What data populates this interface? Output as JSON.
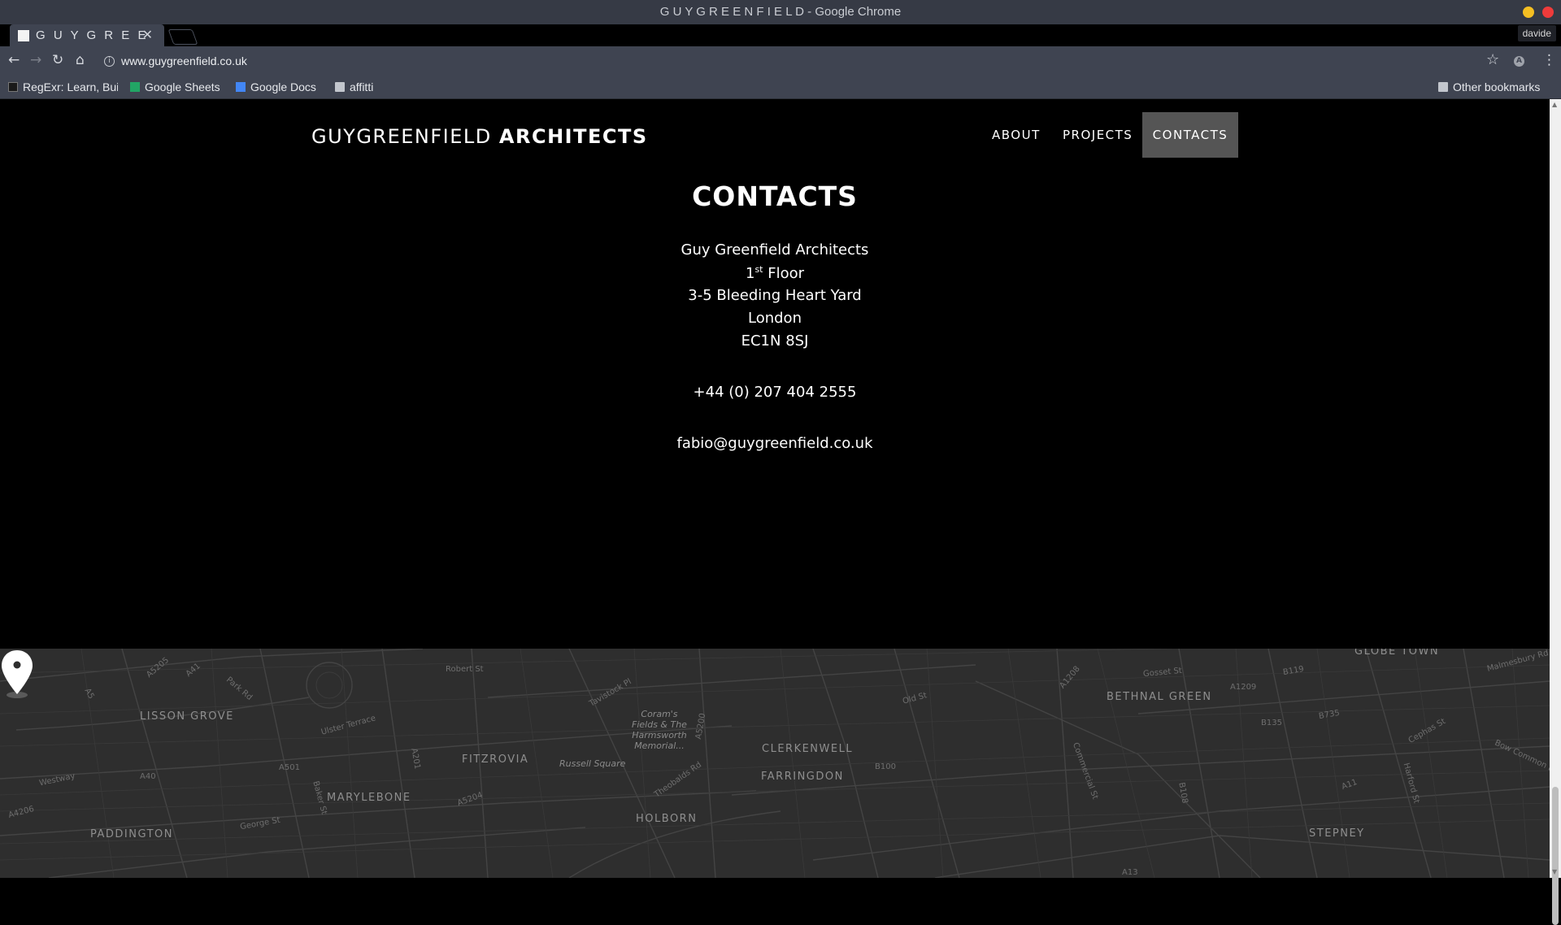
{
  "window": {
    "title": "G U Y G R E E N F I E L D - Google Chrome",
    "user": "davide"
  },
  "tab": {
    "title": "G U Y G R E E N F I E L D"
  },
  "toolbar": {
    "url": "www.guygreenfield.co.uk"
  },
  "bookmarks": {
    "items": [
      "RegExr: Learn, Build",
      "Google Sheets",
      "Google Docs",
      "affitti"
    ],
    "other": "Other bookmarks"
  },
  "site": {
    "logo_light": "GUYGREENFIELD",
    "logo_bold": "ARCHITECTS",
    "nav": [
      "ABOUT",
      "PROJECTS",
      "CONTACTS"
    ],
    "active_nav": "CONTACTS"
  },
  "contacts": {
    "heading": "CONTACTS",
    "company": "Guy Greenfield Architects",
    "floor_num": "1",
    "floor_sup": "st",
    "floor_word": "Floor",
    "street": "3-5 Bleeding Heart Yard",
    "city": "London",
    "postcode": "EC1N 8SJ",
    "phone": "+44 (0) 207 404 2555",
    "email": "fabio@guygreenfield.co.uk"
  },
  "map": {
    "areas": [
      "LISSON GROVE",
      "FITZROVIA",
      "MARYLEBONE",
      "PADDINGTON",
      "HOLBORN",
      "CLERKENWELL",
      "FARRINGDON",
      "BETHNAL GREEN",
      "GLOBE TOWN",
      "STEPNEY"
    ],
    "pois": [
      "Coram's\nFields & The\nHarmsworth\nMemorial...",
      "Russell Square"
    ],
    "roads": [
      "A501",
      "A5205",
      "A41",
      "A5",
      "Park Rd",
      "Ulster Terrace",
      "A40",
      "Westway",
      "A4206",
      "Baker St",
      "A5204",
      "George St",
      "Tavistock Pl",
      "A5200",
      "A201",
      "Old St",
      "A1208",
      "B135",
      "B735",
      "A1209",
      "B119",
      "Cephas St",
      "Bow Common Ln",
      "A11",
      "B108",
      "Commercial St",
      "B100",
      "A13",
      "Harford St",
      "Theobalds Rd",
      "Gosset St",
      "Robert St",
      "Malmesbury Rd"
    ],
    "colors": {
      "background": "#2e2e2e",
      "roads": "#454545",
      "major_roads": "#4f4f4f",
      "pin": "#ffffff"
    }
  }
}
